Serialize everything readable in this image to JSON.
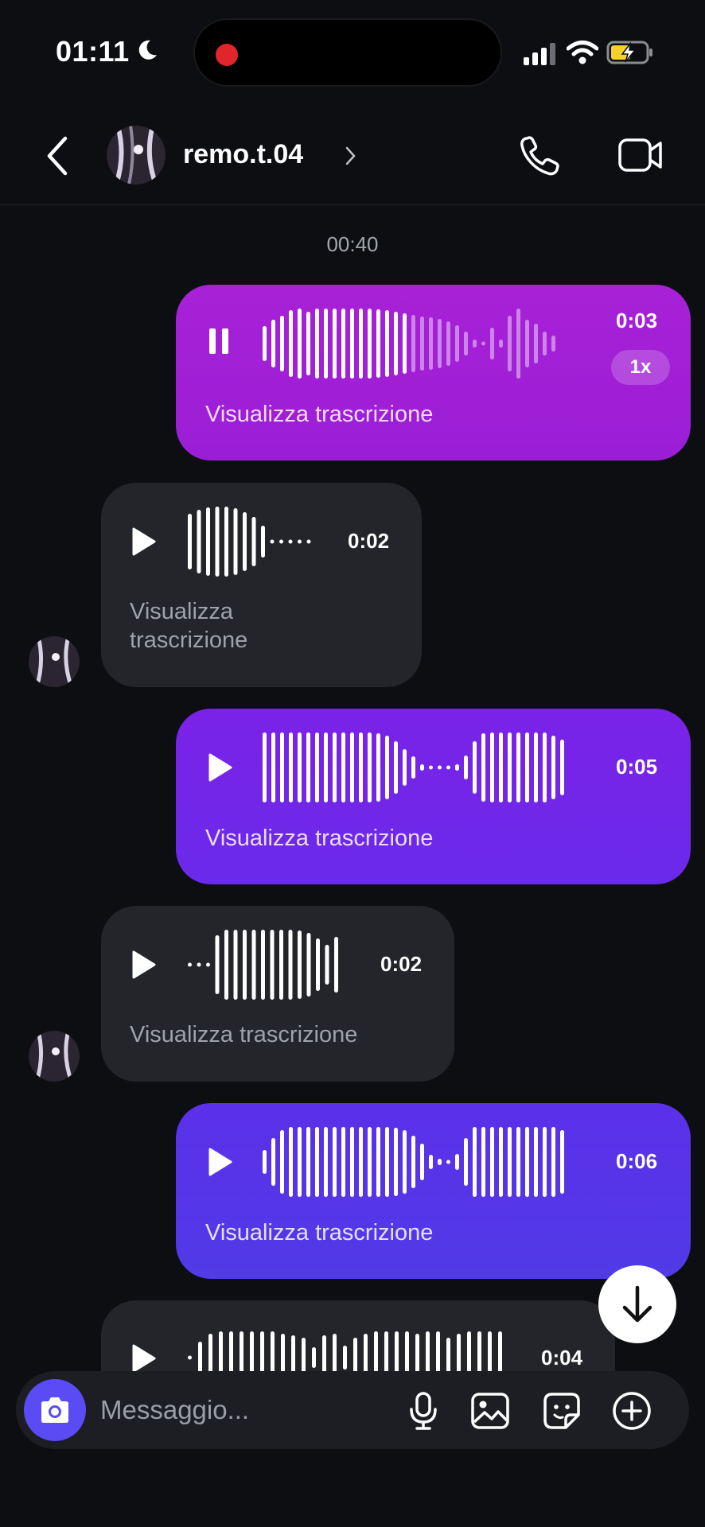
{
  "status": {
    "time": "01:11"
  },
  "header": {
    "username": "remo.t.04"
  },
  "chat": {
    "timestamp": "00:40",
    "messages": [
      {
        "dir": "out",
        "state": "playing",
        "duration": "0:03",
        "speed": "1x",
        "transcript": "Visualizza trascrizione"
      },
      {
        "dir": "in",
        "state": "paused",
        "duration": "0:02",
        "transcript_lines": [
          "Visualizza",
          "trascrizione"
        ]
      },
      {
        "dir": "out",
        "state": "paused",
        "duration": "0:05",
        "transcript": "Visualizza trascrizione"
      },
      {
        "dir": "in",
        "state": "paused",
        "duration": "0:02",
        "transcript": "Visualizza trascrizione"
      },
      {
        "dir": "out",
        "state": "paused",
        "duration": "0:06",
        "transcript": "Visualizza trascrizione"
      },
      {
        "dir": "in",
        "state": "paused",
        "duration": "0:04"
      }
    ]
  },
  "composer": {
    "placeholder": "Messaggio..."
  },
  "icons": [
    "back-icon",
    "phone-icon",
    "video-icon",
    "play-icon",
    "pause-icon",
    "arrow-down-icon",
    "camera-icon",
    "microphone-icon",
    "image-icon",
    "sticker-icon",
    "plus-circle-icon"
  ],
  "colors": {
    "background": "#0c0e12",
    "incoming_bubble": "#23252b",
    "outgoing_1": "#a821d6",
    "outgoing_2": "#7b22e8",
    "outgoing_3": "#5b30e9",
    "camera_button": "#5a4bf4"
  }
}
